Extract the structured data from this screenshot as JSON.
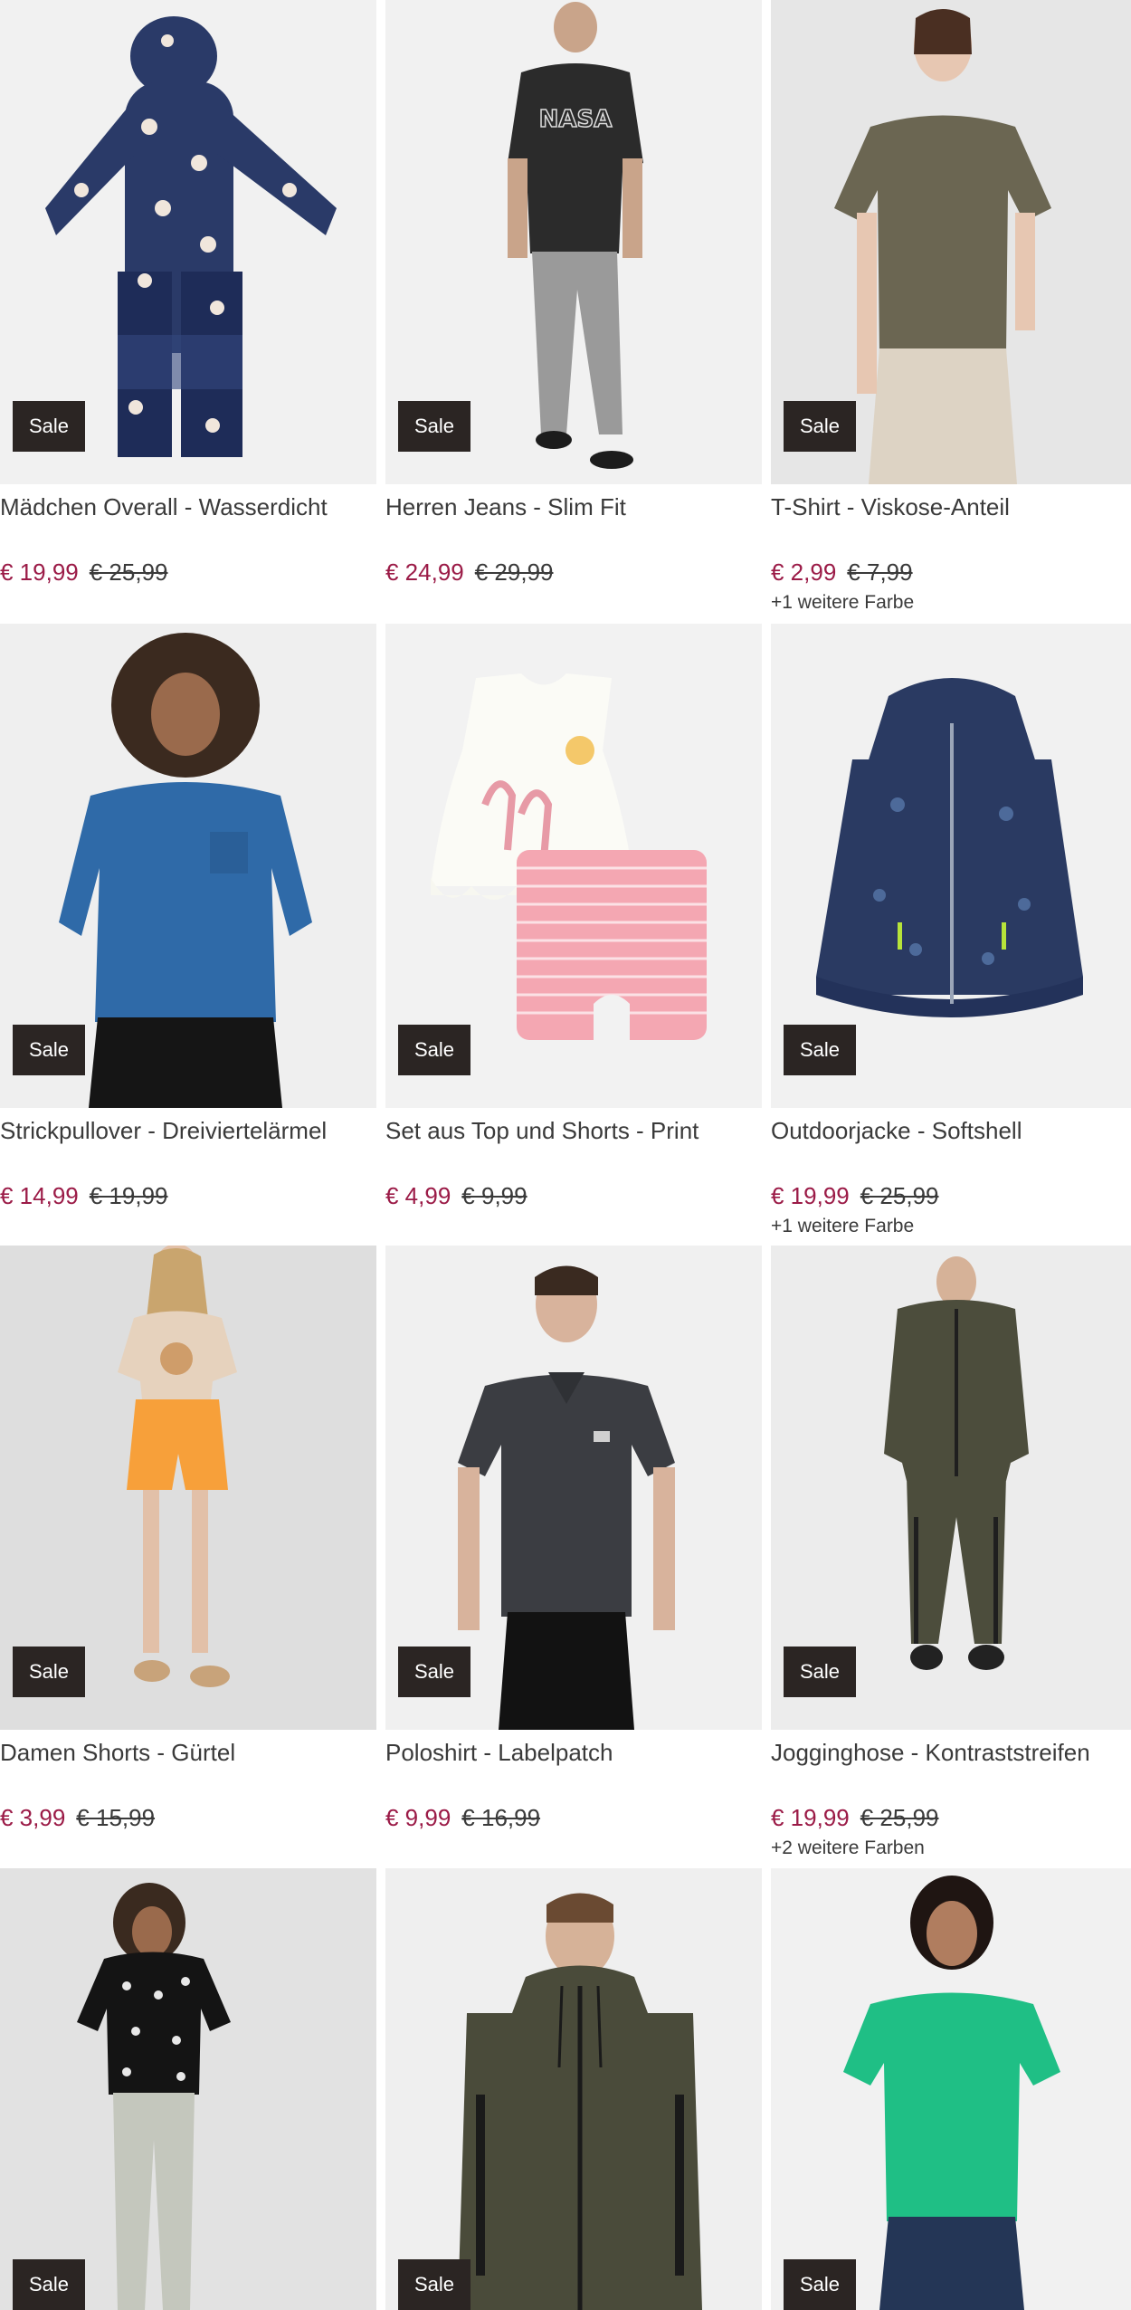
{
  "products": [
    {
      "name": "Mädchen Overall - Wasserdicht",
      "badge": "Sale",
      "price": "€ 19,99",
      "old_price": "€ 25,99",
      "colors": "",
      "image": "overall-image"
    },
    {
      "name": "Herren Jeans - Slim Fit",
      "badge": "Sale",
      "price": "€ 24,99",
      "old_price": "€ 29,99",
      "colors": "",
      "image": "jeans-image"
    },
    {
      "name": "T-Shirt - Viskose-Anteil",
      "badge": "Sale",
      "price": "€ 2,99",
      "old_price": "€ 7,99",
      "colors": "+1 weitere Farbe",
      "image": "tshirt-image"
    },
    {
      "name": "Strickpullover - Dreiviertelärmel",
      "badge": "Sale",
      "price": "€ 14,99",
      "old_price": "€ 19,99",
      "colors": "",
      "image": "pullover-image"
    },
    {
      "name": "Set aus Top und Shorts - Print",
      "badge": "Sale",
      "price": "€ 4,99",
      "old_price": "€ 9,99",
      "colors": "",
      "image": "set-image"
    },
    {
      "name": "Outdoorjacke - Softshell",
      "badge": "Sale",
      "price": "€ 19,99",
      "old_price": "€ 25,99",
      "colors": "+1 weitere Farbe",
      "image": "jacket-image"
    },
    {
      "name": "Damen Shorts - Gürtel",
      "badge": "Sale",
      "price": "€ 3,99",
      "old_price": "€ 15,99",
      "colors": "",
      "image": "shorts-image"
    },
    {
      "name": "Poloshirt - Labelpatch",
      "badge": "Sale",
      "price": "€ 9,99",
      "old_price": "€ 16,99",
      "colors": "",
      "image": "polo-image"
    },
    {
      "name": "Jogginghose - Kontraststreifen",
      "badge": "Sale",
      "price": "€ 19,99",
      "old_price": "€ 25,99",
      "colors": "+2 weitere Farben",
      "image": "jogging-image"
    },
    {
      "name": "",
      "badge": "Sale",
      "price": "",
      "old_price": "",
      "colors": "",
      "image": "printed-shirt-image"
    },
    {
      "name": "",
      "badge": "Sale",
      "price": "",
      "old_price": "",
      "colors": "",
      "image": "hoodie-image"
    },
    {
      "name": "",
      "badge": "Sale",
      "price": "",
      "old_price": "",
      "colors": "",
      "image": "green-shirt-image"
    }
  ],
  "colors": {
    "price": "#9b1b47",
    "badge_bg": "#2b2523",
    "image_bg": "#ededed"
  }
}
